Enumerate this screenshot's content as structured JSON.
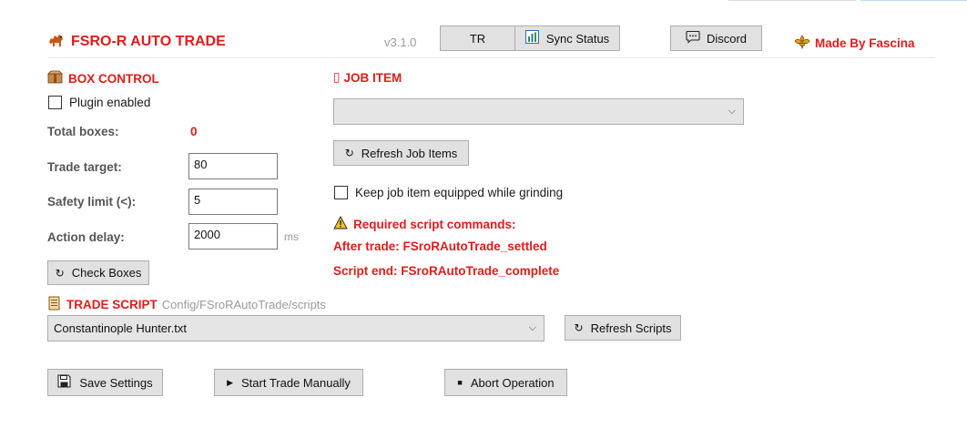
{
  "header": {
    "app_title": "FSRO-R AUTO TRADE",
    "version": "v3.1.0",
    "tr_label": "TR",
    "sync_label": "Sync Status",
    "discord_label": "Discord",
    "made_by": "Made By Fascina"
  },
  "box_control": {
    "title": "BOX CONTROL",
    "plugin_label": "Plugin enabled",
    "plugin_checked": false,
    "total_boxes_label": "Total boxes:",
    "total_boxes_value": "0",
    "trade_target_label": "Trade target:",
    "trade_target_value": "80",
    "safety_limit_label": "Safety limit (<):",
    "safety_limit_value": "5",
    "action_delay_label": "Action delay:",
    "action_delay_value": "2000",
    "action_delay_unit": "ms",
    "check_boxes_label": "Check Boxes"
  },
  "job_item": {
    "title": "JOB ITEM",
    "title_glyph": "▯",
    "selected_value": "",
    "refresh_label": "Refresh Job Items",
    "keep_equipped_label": "Keep job item equipped while grinding",
    "keep_equipped_checked": false,
    "required_title": "Required script commands:",
    "after_trade": "After trade: FSroRAutoTrade_settled",
    "script_end": "Script end: FSroRAutoTrade_complete"
  },
  "trade_script": {
    "title": "TRADE SCRIPT",
    "path": "Config/FSroRAutoTrade/scripts",
    "selected": "Constantinople Hunter.txt",
    "refresh_label": "Refresh Scripts"
  },
  "actions": {
    "save_label": "Save Settings",
    "start_label": "Start Trade Manually",
    "abort_label": "Abort Operation"
  },
  "colors": {
    "accent_red": "#e21b1b",
    "button_bg": "#e1e1e1",
    "label_gray": "#555555"
  }
}
